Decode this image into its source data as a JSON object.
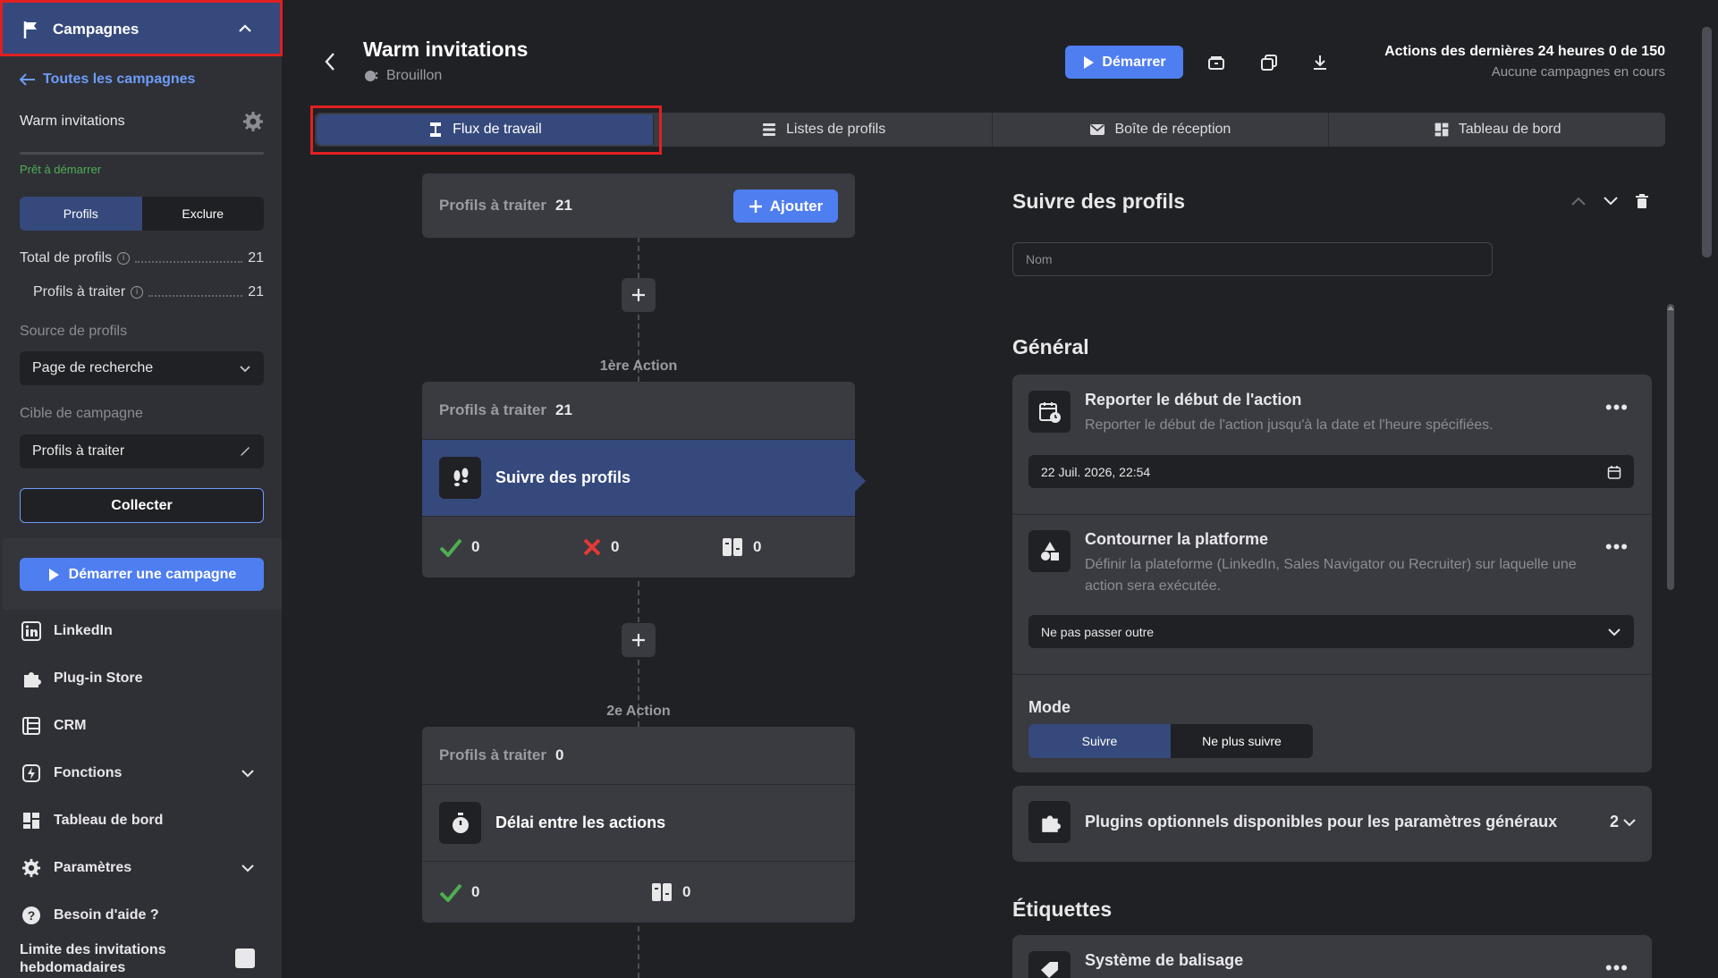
{
  "sidebar": {
    "header": "Campagnes",
    "back_link": "Toutes les campagnes",
    "campaign_name": "Warm invitations",
    "status": "Prêt à démarrer",
    "segment": {
      "left": "Profils",
      "right": "Exclure"
    },
    "total_profiles_label": "Total de profils",
    "total_profiles_value": "21",
    "to_process_label": "Profils à traiter",
    "to_process_value": "21",
    "source_label": "Source de profils",
    "source_value": "Page de recherche",
    "target_label": "Cible de campagne",
    "target_value": "Profils à traiter",
    "collect_button": "Collecter",
    "start_button": "Démarrer une campagne",
    "nav": [
      "LinkedIn",
      "Plug-in Store",
      "CRM",
      "Fonctions",
      "Tableau de bord",
      "Paramètres",
      "Besoin d'aide ?"
    ],
    "limit_label": "Limite des invitations hebdomadaires"
  },
  "header": {
    "title": "Warm invitations",
    "subtitle": "Brouillon",
    "start_button": "Démarrer",
    "actions_title": "Actions des dernières 24 heures 0 de 150",
    "actions_sub": "Aucune campagnes en cours"
  },
  "tabs": [
    "Flux de travail",
    "Listes de profils",
    "Boîte de réception",
    "Tableau de bord"
  ],
  "workflow": {
    "top_label": "Profils à traiter",
    "top_count": "21",
    "add_button": "Ajouter",
    "action1_label": "1ère Action",
    "action1": {
      "label": "Profils à traiter",
      "count": "21",
      "name": "Suivre des profils",
      "ok": "0",
      "fail": "0",
      "other": "0"
    },
    "action2_label": "2e Action",
    "action2": {
      "label": "Profils à traiter",
      "count": "0",
      "name": "Délai entre les actions",
      "ok": "0",
      "other": "0"
    }
  },
  "panel": {
    "title": "Suivre des profils",
    "name_placeholder": "Nom",
    "general": "Général",
    "postpone_title": "Reporter le début de l'action",
    "postpone_desc": "Reporter le début de l'action jusqu'à la date et l'heure spécifiées.",
    "postpone_value": "22 Juil. 2026, 22:54",
    "bypass_title": "Contourner la platforme",
    "bypass_desc": "Définir la plateforme (LinkedIn, Sales Navigator ou Recruiter) sur laquelle une action sera exécutée.",
    "bypass_value": "Ne pas passer outre",
    "mode_label": "Mode",
    "mode_follow": "Suivre",
    "mode_unfollow": "Ne plus suivre",
    "plugins_title": "Plugins optionnels disponibles pour les paramètres généraux",
    "plugins_count": "2",
    "tags_section": "Étiquettes",
    "tags_title": "Système de balisage"
  },
  "colors": {
    "accent": "#4f7ef0",
    "selected": "#35497c",
    "success": "#4caf50",
    "error": "#e53935"
  }
}
